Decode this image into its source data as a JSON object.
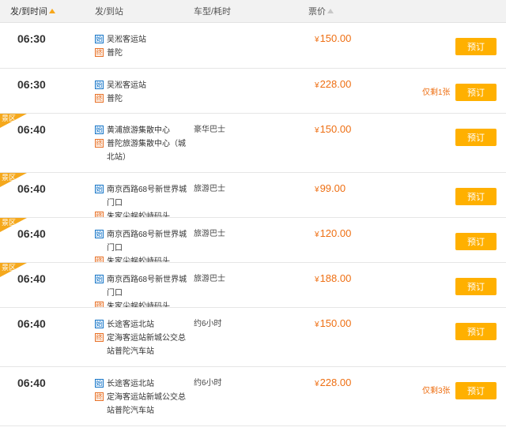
{
  "header": {
    "departure_time": "发/到时间",
    "stations": "发/到站",
    "vehicle_time": "车型/耗时",
    "price": "票价"
  },
  "rows": [
    {
      "time": "06:30",
      "scenic": false,
      "dep_tag": "始",
      "dep_station": "吴淞客运站",
      "arr_tag": "终",
      "arr_station": "普陀",
      "vehicle": "",
      "price": "150.00",
      "yen": "¥",
      "remaining": "",
      "book_label": "预订"
    },
    {
      "time": "06:30",
      "scenic": false,
      "dep_tag": "始",
      "dep_station": "吴淞客运站",
      "arr_tag": "终",
      "arr_station": "普陀",
      "vehicle": "",
      "price": "228.00",
      "yen": "¥",
      "remaining": "仅剩1张",
      "book_label": "预订"
    },
    {
      "time": "06:40",
      "scenic": true,
      "scenic_label": "景区",
      "dep_tag": "始",
      "dep_station": "黄浦旅游集散中心",
      "arr_tag": "终",
      "arr_station": "普陀旅游集散中心（城北站）",
      "vehicle": "豪华巴士",
      "price": "150.00",
      "yen": "¥",
      "remaining": "",
      "book_label": "预订"
    },
    {
      "time": "06:40",
      "scenic": true,
      "scenic_label": "景区",
      "dep_tag": "始",
      "dep_station": "南京西路68号新世界城门口",
      "arr_tag": "终",
      "arr_station": "朱家尖蜈蚣峙码头",
      "vehicle": "旅游巴士",
      "price": "99.00",
      "yen": "¥",
      "remaining": "",
      "book_label": "预订"
    },
    {
      "time": "06:40",
      "scenic": true,
      "scenic_label": "景区",
      "dep_tag": "始",
      "dep_station": "南京西路68号新世界城门口",
      "arr_tag": "终",
      "arr_station": "朱家尖蜈蚣峙码头",
      "vehicle": "旅游巴士",
      "price": "120.00",
      "yen": "¥",
      "remaining": "",
      "book_label": "预订"
    },
    {
      "time": "06:40",
      "scenic": true,
      "scenic_label": "景区",
      "dep_tag": "始",
      "dep_station": "南京西路68号新世界城门口",
      "arr_tag": "终",
      "arr_station": "朱家尖蜈蚣峙码头",
      "vehicle": "旅游巴士",
      "price": "188.00",
      "yen": "¥",
      "remaining": "",
      "book_label": "预订"
    },
    {
      "time": "06:40",
      "scenic": false,
      "dep_tag": "始",
      "dep_station": "长途客运北站",
      "arr_tag": "终",
      "arr_station": "定海客运站新城公交总站普陀汽车站",
      "vehicle": "约6小时",
      "price": "150.00",
      "yen": "¥",
      "remaining": "",
      "book_label": "预订"
    },
    {
      "time": "06:40",
      "scenic": false,
      "dep_tag": "始",
      "dep_station": "长途客运北站",
      "arr_tag": "终",
      "arr_station": "定海客运站新城公交总站普陀汽车站",
      "vehicle": "约6小时",
      "price": "228.00",
      "yen": "¥",
      "remaining": "仅剩3张",
      "book_label": "预订"
    }
  ],
  "colors": {
    "accent_orange": "#ee6f13",
    "book_button": "#ffb000",
    "scenic_ribbon": "#f5a81c",
    "depart_tag": "#1b78c8",
    "arrive_tag": "#e8732b"
  },
  "icons": {
    "sort_active": "sort-up-arrow-icon",
    "sort_inactive": "sort-up-arrow-icon-gray"
  }
}
